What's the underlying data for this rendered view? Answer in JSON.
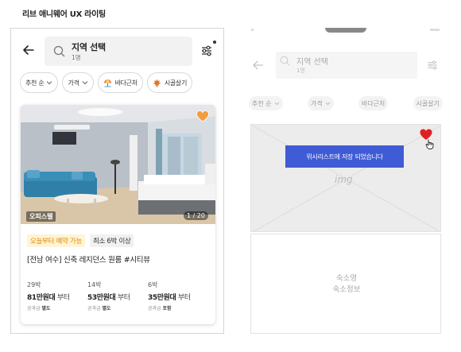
{
  "page": {
    "title": "리브 애니웨어 UX 라이팅"
  },
  "hifi": {
    "search": {
      "title": "지역 선택",
      "subtitle": "1명"
    },
    "chips": [
      {
        "label": "추천 순",
        "icon": "chevron-down-icon"
      },
      {
        "label": "가격",
        "icon": "chevron-down-icon"
      },
      {
        "label": "바다근처",
        "icon": "beach-umbrella-icon"
      },
      {
        "label": "시골살기",
        "icon": "maple-leaf-icon"
      }
    ],
    "card": {
      "room_type": "오피스텔",
      "photo_counter": "1 / 20",
      "tag_availability": "오늘부터 예약 가능",
      "tag_min_stay": "최소 6박 이상",
      "title": "[전남 여수] 신축 레지던스 원룸 #시티뷰",
      "prices": [
        {
          "nights": "29박",
          "amount": "81만원대",
          "suffix": "부터",
          "fee_label": "공과금",
          "fee_value": "별도"
        },
        {
          "nights": "14박",
          "amount": "53만원대",
          "suffix": "부터",
          "fee_label": "공과금",
          "fee_value": "별도"
        },
        {
          "nights": "6박",
          "amount": "35만원대",
          "suffix": "부터",
          "fee_label": "공과금",
          "fee_value": "포함"
        }
      ]
    },
    "colors": {
      "availability_tag_bg": "#fff4d6",
      "availability_tag_text": "#e08a00",
      "heart": "#f29d3e"
    }
  },
  "wireframe": {
    "search": {
      "title": "지역 선택",
      "subtitle": "1명"
    },
    "chips": [
      "추천 순",
      "가격",
      "바다근처",
      "시골살기"
    ],
    "image_placeholder": "img",
    "toast": "위시리스트에 저장 되었습니다",
    "info_line1": "숙소명",
    "info_line2": "숙소정보",
    "colors": {
      "toast_bg": "#3f5bd6",
      "heart": "#e02020"
    }
  }
}
